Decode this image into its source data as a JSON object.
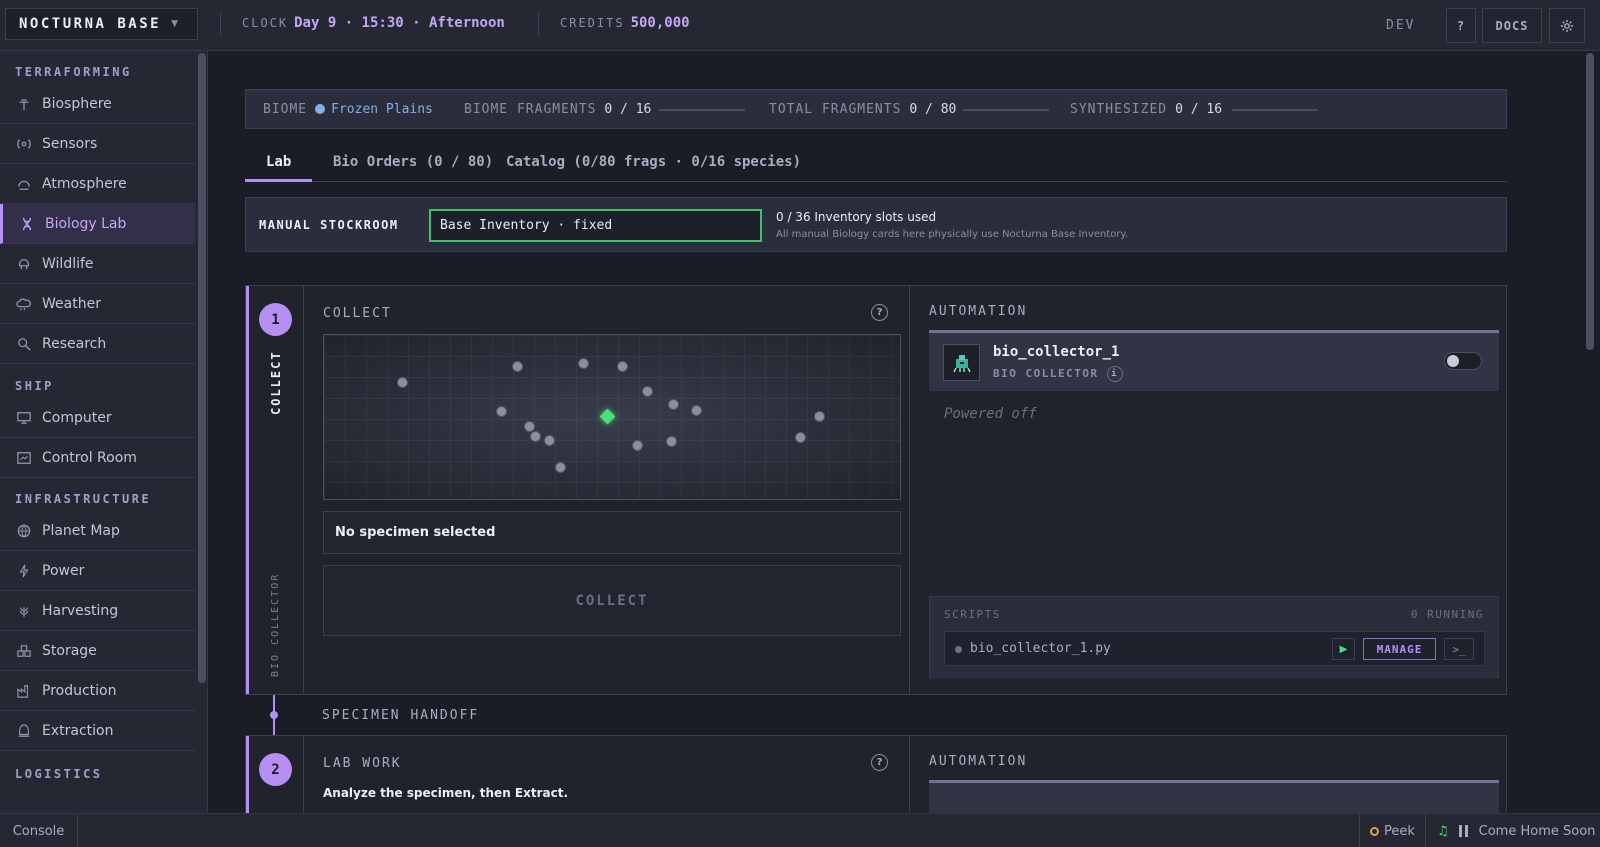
{
  "topbar": {
    "brand": "NOCTURNA BASE",
    "clock_label": "CLOCK",
    "clock_value": "Day 9 · 15:30 · Afternoon",
    "credits_label": "CREDITS",
    "credits_value": "500,000",
    "dev": "DEV",
    "help": "?",
    "docs": "DOCS",
    "settings_icon": "gear-icon"
  },
  "sidebar": {
    "sections": [
      {
        "title": "TERRAFORMING",
        "items": [
          {
            "label": "Biosphere",
            "icon": "biosphere-icon"
          },
          {
            "label": "Sensors",
            "icon": "sensors-icon"
          },
          {
            "label": "Atmosphere",
            "icon": "atmosphere-icon"
          },
          {
            "label": "Biology Lab",
            "icon": "dna-icon",
            "active": true
          },
          {
            "label": "Wildlife",
            "icon": "wildlife-icon"
          },
          {
            "label": "Weather",
            "icon": "cloud-icon"
          },
          {
            "label": "Research",
            "icon": "research-icon"
          }
        ]
      },
      {
        "title": "SHIP",
        "items": [
          {
            "label": "Computer",
            "icon": "monitor-icon"
          },
          {
            "label": "Control Room",
            "icon": "control-room-icon"
          }
        ]
      },
      {
        "title": "INFRASTRUCTURE",
        "items": [
          {
            "label": "Planet Map",
            "icon": "globe-icon"
          },
          {
            "label": "Power",
            "icon": "bolt-icon"
          },
          {
            "label": "Harvesting",
            "icon": "harvest-icon"
          },
          {
            "label": "Storage",
            "icon": "storage-icon"
          },
          {
            "label": "Production",
            "icon": "factory-icon"
          },
          {
            "label": "Extraction",
            "icon": "extraction-icon"
          }
        ]
      },
      {
        "title": "LOGISTICS",
        "items": []
      }
    ]
  },
  "biome_bar": {
    "biome_label": "BIOME",
    "biome_value": "Frozen Plains",
    "biome_color": "#7fb0e8",
    "fragments_label": "BIOME FRAGMENTS",
    "fragments_value": "0 / 16",
    "fragments_progress": 0,
    "total_label": "TOTAL FRAGMENTS",
    "total_value": "0 / 80",
    "total_progress": 0,
    "synth_label": "SYNTHESIZED",
    "synth_value": "0 / 16",
    "synth_progress": 0
  },
  "tabs": [
    {
      "label": "Lab",
      "active": true
    },
    {
      "label": "Bio Orders (0 / 80)"
    },
    {
      "label": "Catalog (0/80 frags · 0/16 species)"
    }
  ],
  "stockroom": {
    "title": "MANUAL STOCKROOM",
    "field_value": "Base Inventory · fixed",
    "used": "0 / 36 Inventory slots used",
    "note": "All manual Biology cards here physically use Nocturna Base Inventory."
  },
  "stage1": {
    "number": "1",
    "rail_title": "COLLECT",
    "rail_sub": "BIO COLLECTOR",
    "header": "COLLECT",
    "help": "?",
    "selection": "No specimen selected",
    "collect_button": "COLLECT",
    "automation_label": "AUTOMATION",
    "unit_name": "bio_collector_1",
    "unit_type": "BIO COLLECTOR",
    "unit_info": "i",
    "unit_on": false,
    "status": "Powered off",
    "scripts_label": "SCRIPTS",
    "running": "0 RUNNING",
    "script_file": "bio_collector_1.py",
    "manage": "MANAGE",
    "terminal": ">_"
  },
  "handoff": "SPECIMEN HANDOFF",
  "stage2": {
    "number": "2",
    "header": "LAB WORK",
    "help": "?",
    "instruction": "Analyze the specimen, then Extract.",
    "automation_label": "AUTOMATION"
  },
  "bottombar": {
    "console": "Console",
    "peek": "Peek",
    "track": "Come Home Soon"
  }
}
